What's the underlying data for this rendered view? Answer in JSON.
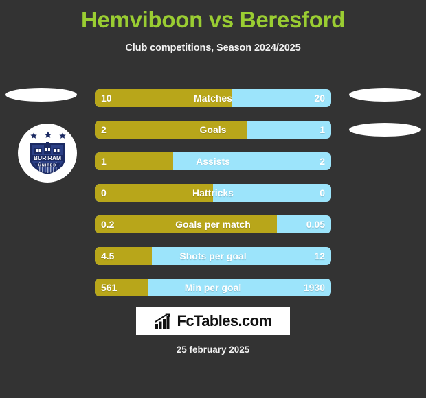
{
  "header": {
    "title": "Hemviboon vs Beresford",
    "subtitle": "Club competitions, Season 2024/2025",
    "title_color": "#9ACD32"
  },
  "colors": {
    "background": "#333333",
    "home_bar": "#B8A61A",
    "away_bar": "#9CE4FB",
    "text": "#FFFFFF"
  },
  "badge": {
    "club_name": "BURIRAM",
    "club_suffix": "UNITED",
    "stars": 3
  },
  "chart_data": {
    "type": "bar",
    "title": "Hemviboon vs Beresford",
    "subtitle": "Club competitions, Season 2024/2025",
    "orientation": "horizontal-diverging",
    "series": [
      {
        "name": "Hemviboon",
        "color": "#B8A61A",
        "values": [
          10,
          2,
          1,
          0,
          0.2,
          4.5,
          561
        ]
      },
      {
        "name": "Beresford",
        "color": "#9CE4FB",
        "values": [
          20,
          1,
          2,
          0,
          0.05,
          12,
          1930
        ]
      }
    ],
    "categories": [
      "Matches",
      "Goals",
      "Assists",
      "Hattricks",
      "Goals per match",
      "Shots per goal",
      "Min per goal"
    ],
    "rows": [
      {
        "label": "Matches",
        "home": "10",
        "away": "20",
        "home_pct": 58
      },
      {
        "label": "Goals",
        "home": "2",
        "away": "1",
        "home_pct": 64.5
      },
      {
        "label": "Assists",
        "home": "1",
        "away": "2",
        "home_pct": 33
      },
      {
        "label": "Hattricks",
        "home": "0",
        "away": "0",
        "home_pct": 50
      },
      {
        "label": "Goals per match",
        "home": "0.2",
        "away": "0.05",
        "home_pct": 77
      },
      {
        "label": "Shots per goal",
        "home": "4.5",
        "away": "12",
        "home_pct": 24
      },
      {
        "label": "Min per goal",
        "home": "561",
        "away": "1930",
        "home_pct": 22.5
      }
    ]
  },
  "footer": {
    "brand": "FcTables.com",
    "date": "25 february 2025"
  }
}
